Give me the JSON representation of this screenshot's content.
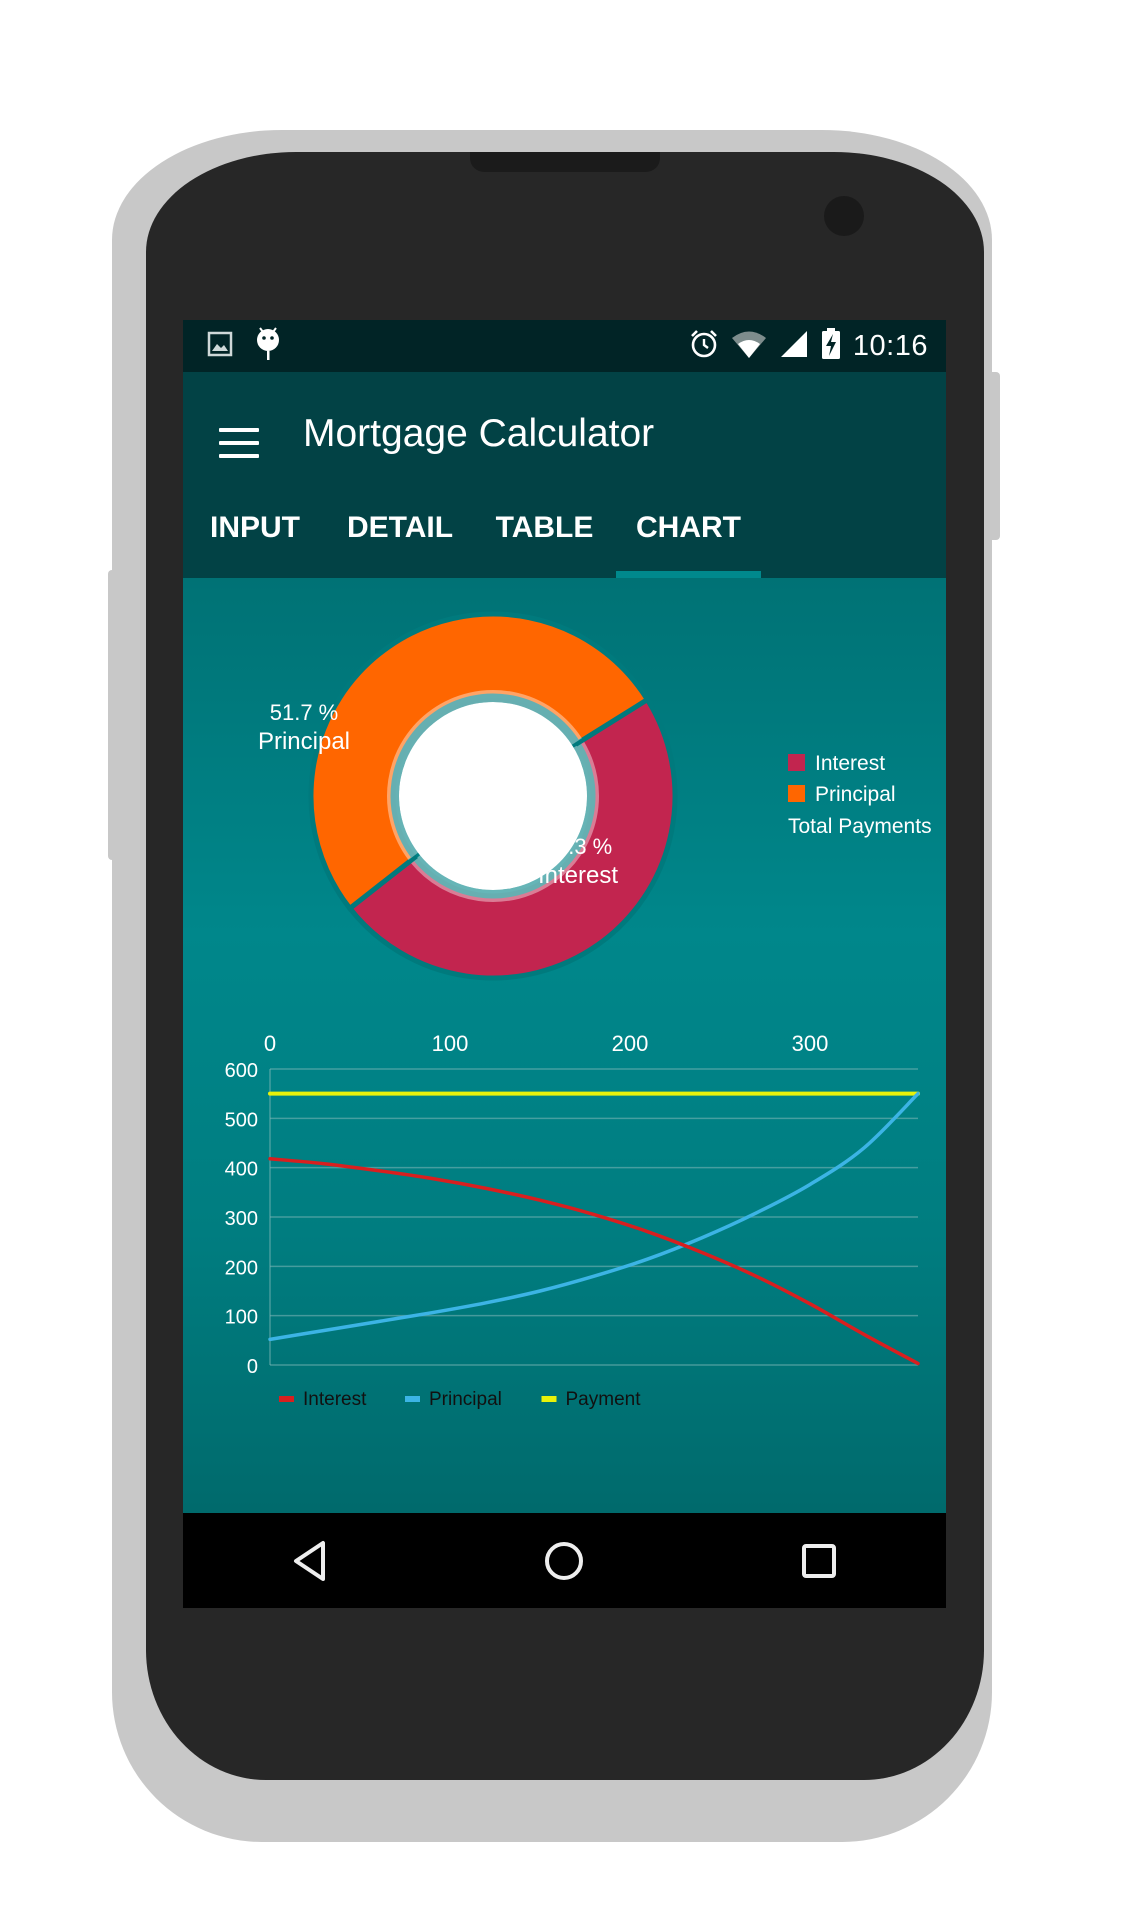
{
  "status_bar": {
    "left_icons": [
      "image-icon",
      "android-debug-icon"
    ],
    "right_icons": [
      "alarm-icon",
      "wifi-icon",
      "cell-signal-icon",
      "battery-charging-icon"
    ],
    "time": "10:16"
  },
  "app_bar": {
    "menu_icon": "hamburger-menu-icon",
    "title": "Mortgage Calculator"
  },
  "tabs": [
    {
      "label": "INPUT",
      "active": false
    },
    {
      "label": "DETAIL",
      "active": false
    },
    {
      "label": "TABLE",
      "active": false
    },
    {
      "label": "CHART",
      "active": true
    }
  ],
  "colors": {
    "status_bar": "#012426",
    "app_bar": "#024245",
    "tab_indicator": "#00898d",
    "content_bg": "#00797c",
    "interest_pie": "#c2254f",
    "principal_pie": "#ff6600",
    "interest_line": "#d81f1f",
    "principal_line": "#3cb4e5",
    "payment_line": "#e8f20a"
  },
  "navigation_bar": {
    "buttons": [
      "back-icon",
      "home-icon",
      "recents-icon"
    ]
  },
  "chart_data": [
    {
      "type": "pie",
      "style": "donut",
      "title": "Total Payments",
      "slices": [
        {
          "label": "Interest",
          "value": 48.3,
          "display": "48.3 %",
          "color": "#c2254f"
        },
        {
          "label": "Principal",
          "value": 51.7,
          "display": "51.7 %",
          "color": "#ff6600"
        }
      ],
      "legend": [
        "Interest",
        "Principal",
        "Total Payments"
      ],
      "legend_position": "right"
    },
    {
      "type": "line",
      "title": "",
      "xlabel": "",
      "ylabel": "",
      "x_axis_position": "top",
      "xlim": [
        0,
        360
      ],
      "ylim": [
        0,
        600
      ],
      "x_ticks": [
        "0",
        "100",
        "200",
        "300"
      ],
      "x_tick_values": [
        0,
        100,
        200,
        300
      ],
      "y_ticks": [
        "600",
        "500",
        "400",
        "300",
        "200",
        "100",
        "0"
      ],
      "y_tick_values": [
        600,
        500,
        400,
        300,
        200,
        100,
        0
      ],
      "grid": true,
      "x": [
        0,
        30,
        60,
        90,
        120,
        150,
        180,
        210,
        240,
        270,
        300,
        330,
        360
      ],
      "series": [
        {
          "name": "Interest",
          "color": "#d81f1f",
          "values": [
            418,
            408,
            394,
            378,
            358,
            334,
            305,
            270,
            228,
            180,
            124,
            62,
            3
          ]
        },
        {
          "name": "Principal",
          "color": "#3cb4e5",
          "values": [
            52,
            70,
            88,
            106,
            126,
            150,
            180,
            215,
            258,
            308,
            366,
            440,
            550
          ]
        },
        {
          "name": "Payment",
          "color": "#e8f20a",
          "values": [
            550,
            550,
            550,
            550,
            550,
            550,
            550,
            550,
            550,
            550,
            550,
            550,
            550
          ]
        }
      ],
      "legend": [
        "Interest",
        "Principal",
        "Payment"
      ],
      "legend_position": "bottom-left"
    }
  ]
}
